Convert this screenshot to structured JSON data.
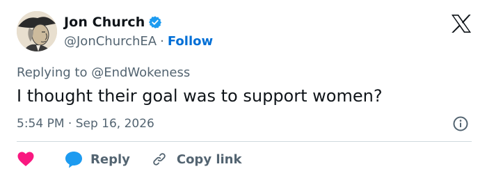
{
  "author": {
    "name": "Jon Church",
    "handle": "@JonChurchEA",
    "separator": "·",
    "follow_label": "Follow",
    "verified_color": "#1d9bf0"
  },
  "reply": {
    "prefix": "Replying to ",
    "mention": "@EndWokeness"
  },
  "tweet": {
    "text": "I thought their goal was to support women?",
    "timestamp": "5:54 PM · Sep 16, 2026"
  },
  "actions": {
    "like_color": "#f91880",
    "reply_label": "Reply",
    "reply_icon_color": "#1d9bf0",
    "copy_link_label": "Copy link"
  },
  "icons": {
    "brand": "x-logo-icon",
    "info": "info-icon",
    "like": "heart-icon",
    "reply": "speech-bubble-icon",
    "copy": "link-icon"
  }
}
